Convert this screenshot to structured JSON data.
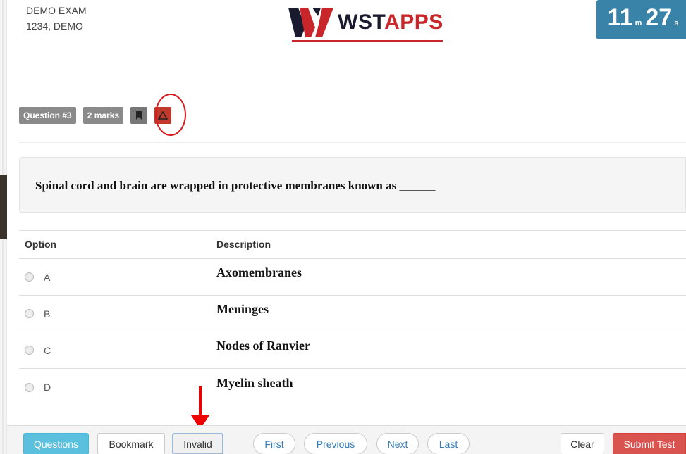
{
  "header": {
    "exam_title": "DEMO EXAM",
    "candidate": "1234, DEMO",
    "logo_ws": "WST",
    "logo_apps": "APPS",
    "timer_minutes": "11",
    "timer_minutes_unit": "m",
    "timer_seconds": "27",
    "timer_seconds_unit": "s"
  },
  "question": {
    "number_label": "Question #3",
    "marks_label": "2 marks",
    "bookmark_icon": "bookmark-icon",
    "invalid_icon": "warning-icon",
    "text": "Spinal cord and brain are wrapped in protective membranes known as ______"
  },
  "options_table": {
    "col_option": "Option",
    "col_description": "Description",
    "rows": [
      {
        "letter": "A",
        "description": "Axomembranes",
        "selected": false
      },
      {
        "letter": "B",
        "description": "Meninges",
        "selected": false
      },
      {
        "letter": "C",
        "description": "Nodes of Ranvier",
        "selected": false
      },
      {
        "letter": "D",
        "description": "Myelin sheath",
        "selected": false
      }
    ]
  },
  "footer": {
    "questions": "Questions",
    "bookmark": "Bookmark",
    "invalid": "Invalid",
    "first": "First",
    "previous": "Previous",
    "next": "Next",
    "last": "Last",
    "clear": "Clear",
    "submit": "Submit Test"
  },
  "colors": {
    "timer_bg": "#3a83a8",
    "brand_red": "#c8262a",
    "primary": "#5bc0de",
    "danger": "#d9534f",
    "annotation": "#e00000"
  }
}
